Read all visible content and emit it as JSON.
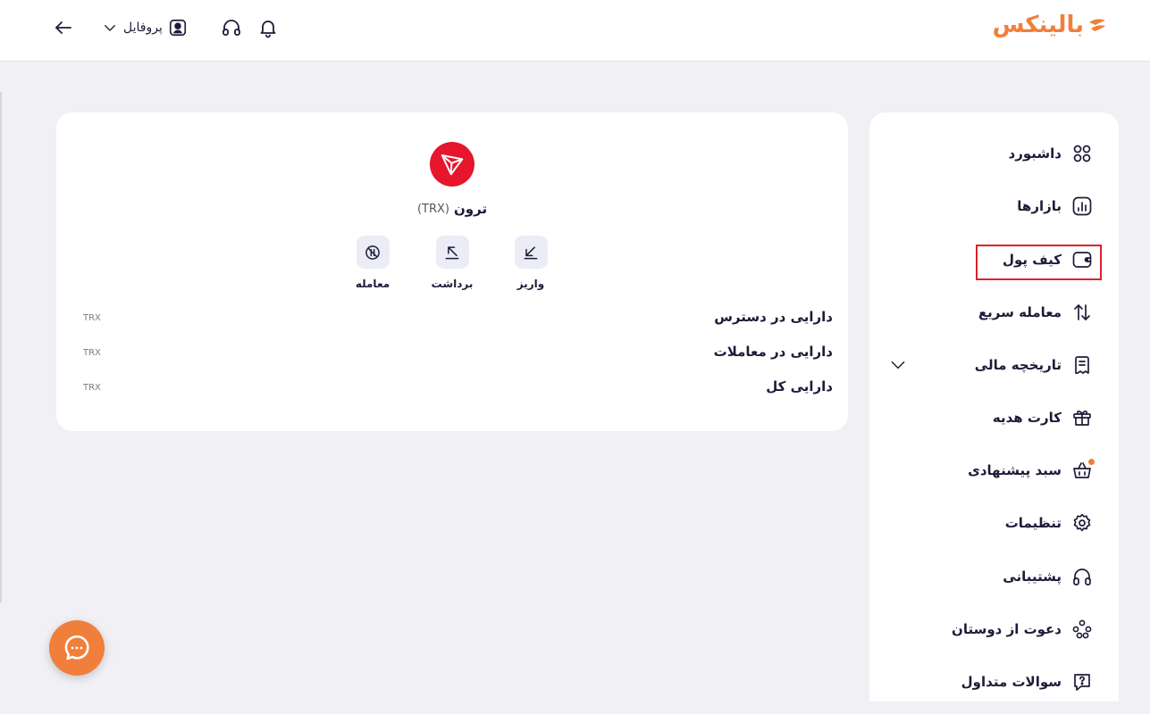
{
  "header": {
    "logo_text": "بالینکس",
    "profile_label": "پروفایل",
    "icons": [
      "back-arrow-icon",
      "chevron-down-icon",
      "user-icon",
      "headset-icon",
      "bell-icon"
    ]
  },
  "sidebar": {
    "items": [
      {
        "label": "داشبورد",
        "icon": "grid-icon"
      },
      {
        "label": "بازارها",
        "icon": "chart-bars-icon"
      },
      {
        "label": "کیف پول",
        "icon": "wallet-icon",
        "active": true
      },
      {
        "label": "معامله سریع",
        "icon": "swap-arrows-icon"
      },
      {
        "label": "تاریخچه مالی",
        "icon": "receipt-icon",
        "expandable": true
      },
      {
        "label": "کارت هدیه",
        "icon": "gift-icon"
      },
      {
        "label": "سبد پیشنهادی",
        "icon": "basket-icon",
        "badge_dot": true
      },
      {
        "label": "تنظیمات",
        "icon": "gear-icon"
      },
      {
        "label": "پشتیبانی",
        "icon": "headset-icon"
      },
      {
        "label": "دعوت از دوستان",
        "icon": "people-icon"
      },
      {
        "label": "سوالات متداول",
        "icon": "question-bubble-icon"
      }
    ]
  },
  "coin": {
    "name": "ترون",
    "symbol": "(TRX)",
    "logo_color": "#e6162d"
  },
  "actions": [
    {
      "label": "واریز",
      "icon": "deposit-arrow-icon"
    },
    {
      "label": "برداشت",
      "icon": "withdraw-arrow-icon"
    },
    {
      "label": "معامله",
      "icon": "trade-icon"
    }
  ],
  "assets": [
    {
      "label": "دارایی در دسترس",
      "unit": "TRX"
    },
    {
      "label": "دارایی در معاملات",
      "unit": "TRX"
    },
    {
      "label": "دارایی کل",
      "unit": "TRX"
    }
  ],
  "colors": {
    "accent": "#f07f3c",
    "highlight_border": "#d9232d",
    "background": "#f0f0f5"
  }
}
